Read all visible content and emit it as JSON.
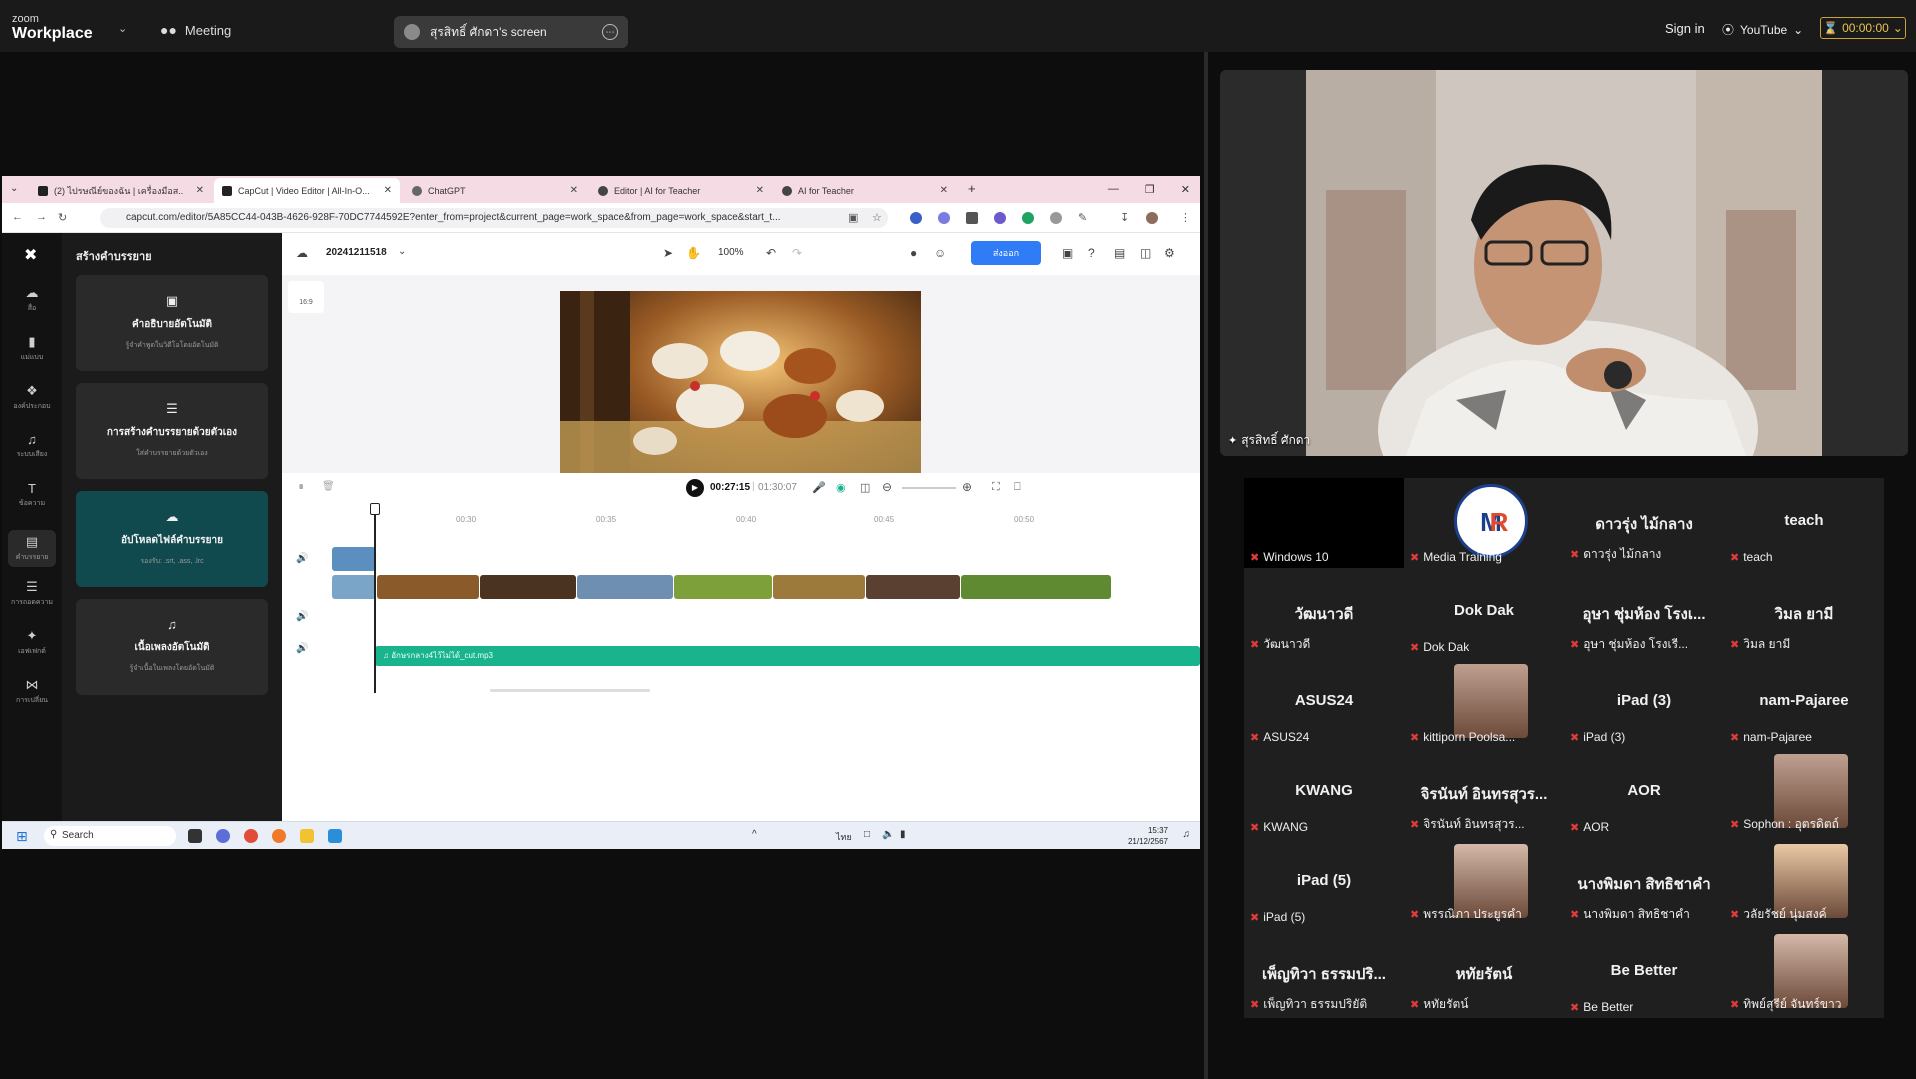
{
  "zoom": {
    "logo_small": "zoom",
    "logo_big": "Workplace",
    "meeting_label": "Meeting",
    "share_label": "สุรสิทธิ์ ศักดา's screen",
    "sign_in": "Sign in",
    "youtube": "YouTube",
    "timer": "00:00:00",
    "colors": {
      "timer": "#e9c44e",
      "bar": "#1a1a1a"
    }
  },
  "browser": {
    "tabs": [
      {
        "label": "(2) ไปรษณีย์ของฉัน | เครื่องมือส..."
      },
      {
        "label": "CapCut | Video Editor | All-In-O..."
      },
      {
        "label": "ChatGPT"
      },
      {
        "label": "Editor | AI for Teacher"
      },
      {
        "label": "AI for Teacher"
      }
    ],
    "url": "capcut.com/editor/5A85CC44-043B-4626-928F-70DC7744592E?enter_from=project&current_page=work_space&from_page=work_space&start_t..."
  },
  "capcut": {
    "rail": [
      {
        "icon": "media-icon",
        "label": "สื่อ"
      },
      {
        "icon": "template-icon",
        "label": "แม่แบบ"
      },
      {
        "icon": "elements-icon",
        "label": "องค์ประกอบ"
      },
      {
        "icon": "audio-icon",
        "label": "ระบบเสียง"
      },
      {
        "icon": "text-icon",
        "label": "ข้อความ"
      },
      {
        "icon": "captions-icon",
        "label": "คำบรรยาย"
      },
      {
        "icon": "transcript-icon",
        "label": "การถอดความ"
      },
      {
        "icon": "effects-icon",
        "label": "เอฟเฟกต์"
      },
      {
        "icon": "transitions-icon",
        "label": "การเปลี่ยน"
      }
    ],
    "panel_title": "สร้างคำบรรยาย",
    "cards": [
      {
        "title": "คำอธิบายอัตโนมัติ",
        "sub": "รู้จำคำพูดในวิดีโอโดยอัตโนมัติ"
      },
      {
        "title": "การสร้างคำบรรยายด้วยตัวเอง",
        "sub": "ใส่คำบรรยายด้วยตัวเอง"
      },
      {
        "title": "อัปโหลดไฟล์คำบรรยาย",
        "sub": "รองรับ: .srt, .ass, .lrc"
      },
      {
        "title": "เนื้อเพลงอัตโนมัติ",
        "sub": "รู้จำเนื้อในเพลงโดยอัตโนมัติ"
      }
    ],
    "project_name": "20241211518",
    "zoom_level": "100%",
    "export_label": "ส่งออก",
    "ratio": "16:9",
    "current_time": "00:27:15",
    "total_time": "01:30:07",
    "ruler": [
      "00:30",
      "00:35",
      "00:40",
      "00:45",
      "00:50"
    ],
    "audio_clip": "อักษรกลาง4ไว้ไม่ได้_cut.mp3"
  },
  "taskbar": {
    "search": "Search",
    "lang": "ไทย",
    "time": "15:37",
    "date": "21/12/2567"
  },
  "speaker": {
    "name": "สุรสิทธิ์ ศักดา"
  },
  "gallery": [
    {
      "big": "",
      "label": "Windows 10",
      "pic": "black"
    },
    {
      "big": "",
      "label": "Media Training",
      "pic": "logo"
    },
    {
      "big": "ดาวรุ่ง ไม้กลาง",
      "label": "ดาวรุ่ง ไม้กลาง"
    },
    {
      "big": "teach",
      "label": "teach"
    },
    {
      "big": "วัฒนาวดี",
      "label": "วัฒนาวดี"
    },
    {
      "big": "Dok Dak",
      "label": "Dok Dak"
    },
    {
      "big": "อุษา ชุ่มห้อง โรงเ...",
      "label": "อุษา ชุ่มห้อง โรงเรี..."
    },
    {
      "big": "วิมล ยามี",
      "label": "วิมล ยามี"
    },
    {
      "big": "ASUS24",
      "label": "ASUS24"
    },
    {
      "big": "",
      "label": "kittiporn Poolsa...",
      "pic": "photo"
    },
    {
      "big": "iPad (3)",
      "label": "iPad (3)"
    },
    {
      "big": "nam-Pajaree",
      "label": "nam-Pajaree"
    },
    {
      "big": "KWANG",
      "label": "KWANG"
    },
    {
      "big": "จิรนันท์ อินทรสุวร...",
      "label": "จิรนันท์ อินทรสุวร..."
    },
    {
      "big": "AOR",
      "label": "AOR"
    },
    {
      "big": "",
      "label": "Sophon : อุตรดิตถ์",
      "pic": "photo"
    },
    {
      "big": "iPad (5)",
      "label": "iPad (5)"
    },
    {
      "big": "",
      "label": "พรรณิภา ประยูรคำ",
      "pic": "photo"
    },
    {
      "big": "นางพิมดา สิทธิชาคำ",
      "label": "นางพิมดา สิทธิชาคำ"
    },
    {
      "big": "",
      "label": "วลัยรัชย์ นุ่มสงค์",
      "pic": "photo"
    },
    {
      "big": "เพ็ญทิวา ธรรมปริ...",
      "label": "เพ็ญทิวา ธรรมปริยัติ"
    },
    {
      "big": "หทัยรัตน์",
      "label": "หทัยรัตน์"
    },
    {
      "big": "Be Better",
      "label": "Be Better"
    },
    {
      "big": "",
      "label": "ทิพย์สุรีย์ จันทร์ขาว",
      "pic": "photo"
    }
  ]
}
